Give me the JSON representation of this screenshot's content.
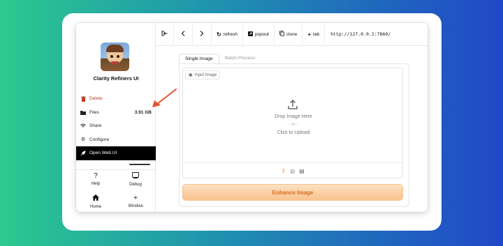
{
  "app": {
    "name": "Clarity Refiners UI"
  },
  "sidebar": {
    "items": [
      {
        "label": "Delete",
        "icon": "trash-icon"
      },
      {
        "label": "Files",
        "value": "3.91 GB",
        "icon": "folder-icon"
      },
      {
        "label": "Share",
        "icon": "wifi-icon"
      },
      {
        "label": "Configure",
        "icon": "gear-icon"
      },
      {
        "label": "Open Web UI",
        "icon": "rocket-icon"
      }
    ],
    "tools": [
      {
        "label": "Help",
        "icon": "question-icon"
      },
      {
        "label": "Debug",
        "icon": "terminal-icon"
      },
      {
        "label": "Home",
        "icon": "home-icon"
      },
      {
        "label": "Window",
        "icon": "plus-icon"
      }
    ]
  },
  "toolbar": {
    "refresh": "refresh",
    "popout": "popout",
    "clone": "clone",
    "tab": "tab",
    "url": "http://127.0.0.1:7860/"
  },
  "main": {
    "tabs": [
      "Single Image",
      "Batch Process"
    ],
    "input_label": "Input Image",
    "drop_text": "Drop Image Here",
    "or_text": "- or -",
    "click_text": "Click to Upload",
    "enhance_button": "Enhance Image"
  },
  "colors": {
    "accent": "#d86a18",
    "delete": "#c0392b",
    "arrow": "#e4532e"
  }
}
